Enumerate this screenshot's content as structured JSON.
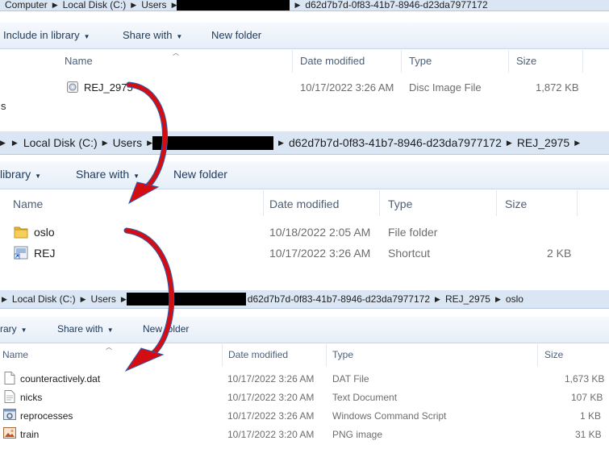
{
  "panel1": {
    "crumbs": [
      "Computer",
      "Local Disk (C:)",
      "Users",
      "d62d7b7d-0f83-41b7-8946-d23da7977172"
    ],
    "toolbar": [
      "Include in library",
      "Share with",
      "New folder"
    ],
    "headers": [
      "Name",
      "Date modified",
      "Type",
      "Size"
    ],
    "rows": [
      {
        "name": "REJ_2975",
        "date": "10/17/2022 3:26 AM",
        "type": "Disc Image File",
        "size": "1,872 KB",
        "icon": "disc-image-icon"
      }
    ],
    "side_fragment": "s"
  },
  "panel2": {
    "crumbs": [
      "Local Disk (C:)",
      "Users",
      "d62d7b7d-0f83-41b7-8946-d23da7977172",
      "REJ_2975"
    ],
    "toolbar": [
      "library",
      "Share with",
      "New folder"
    ],
    "headers": [
      "Name",
      "Date modified",
      "Type",
      "Size"
    ],
    "rows": [
      {
        "name": "oslo",
        "date": "10/18/2022 2:05 AM",
        "type": "File folder",
        "size": "",
        "icon": "folder-icon"
      },
      {
        "name": "REJ",
        "date": "10/17/2022 3:26 AM",
        "type": "Shortcut",
        "size": "2 KB",
        "icon": "shortcut-icon"
      }
    ]
  },
  "panel3": {
    "crumbs": [
      "Local Disk (C:)",
      "Users",
      "d62d7b7d-0f83-41b7-8946-d23da7977172",
      "REJ_2975",
      "oslo"
    ],
    "toolbar": [
      "rary",
      "Share with",
      "New folder"
    ],
    "headers": [
      "Name",
      "Date modified",
      "Type",
      "Size"
    ],
    "rows": [
      {
        "name": "counteractively.dat",
        "date": "10/17/2022 3:26 AM",
        "type": "DAT File",
        "size": "1,673 KB",
        "icon": "file-icon"
      },
      {
        "name": "nicks",
        "date": "10/17/2022 3:20 AM",
        "type": "Text Document",
        "size": "107 KB",
        "icon": "text-file-icon"
      },
      {
        "name": "reprocesses",
        "date": "10/17/2022 3:26 AM",
        "type": "Windows Command Script",
        "size": "1 KB",
        "icon": "script-icon"
      },
      {
        "name": "train",
        "date": "10/17/2022 3:20 AM",
        "type": "PNG image",
        "size": "31 KB",
        "icon": "image-icon"
      }
    ]
  },
  "colors": {
    "redaction": "#000000",
    "arrow": "#d40d12",
    "arrow_outline": "#2a5db0",
    "address_bar": "#dbe6f4"
  }
}
